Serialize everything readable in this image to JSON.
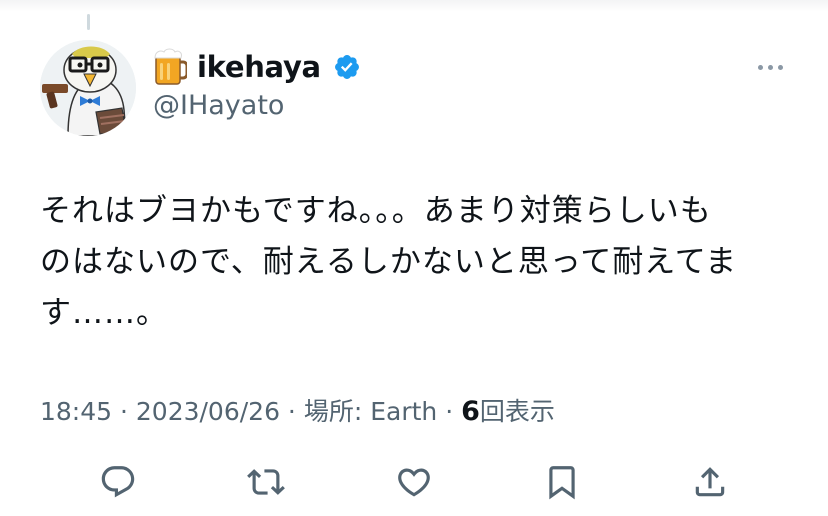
{
  "author": {
    "display_name": "ikehaya",
    "name_emoji_icon": "beer-mug-icon",
    "verified_icon": "verified-badge-icon",
    "handle": "@IHayato"
  },
  "tweet": {
    "text": "それはブヨかもですね。。。あまり対策らしいも\nのはないので、耐えるしかないと思って耐えてま\nす……。"
  },
  "meta": {
    "time": "18:45",
    "date": "2023/06/26",
    "location_label": "場所: Earth",
    "separator": " · ",
    "view_count": "6",
    "view_label": "回表示"
  },
  "actions": [
    {
      "name": "reply",
      "icon": "reply-icon"
    },
    {
      "name": "retweet",
      "icon": "retweet-icon"
    },
    {
      "name": "like",
      "icon": "like-icon"
    },
    {
      "name": "bookmark",
      "icon": "bookmark-icon"
    },
    {
      "name": "share",
      "icon": "share-icon"
    }
  ],
  "colors": {
    "text": "#0f1419",
    "secondary": "#536471",
    "verified": "#1d9bf0",
    "icon": "#536471"
  }
}
